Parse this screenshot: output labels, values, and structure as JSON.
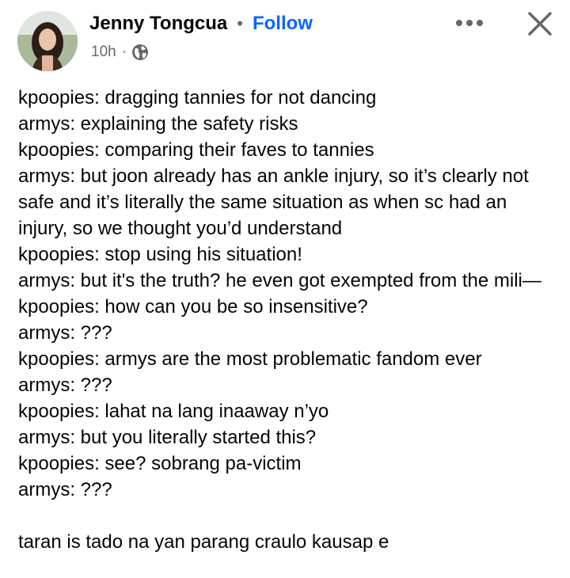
{
  "post": {
    "author": {
      "name": "Jenny Tongcua",
      "avatar_icon": "profile-photo"
    },
    "header": {
      "separator": "•",
      "follow_label": "Follow",
      "timestamp": "10h",
      "meta_separator": "·",
      "audience_icon": "globe-icon"
    },
    "actions": {
      "more_icon": "more-options-icon",
      "close_icon": "close-icon"
    },
    "lines": [
      "kpoopies: dragging tannies for not dancing",
      "armys: explaining the safety risks",
      "kpoopies: comparing their faves to tannies",
      "armys: but joon already has an ankle injury, so it’s clearly not safe and it’s literally the same situation as when sc had an injury, so we thought you’d understand",
      "kpoopies: stop using his situation!",
      "armys: but it's the truth? he even got exempted from the mili—",
      "kpoopies: how can you be so insensitive?",
      "armys: ???",
      "kpoopies: armys are the most problematic fandom ever",
      "armys: ???",
      "kpoopies: lahat na lang inaaway n’yo",
      "armys: but you literally started this?",
      "kpoopies: see? sobrang pa-victim",
      "armys: ???"
    ],
    "closing_line": "taran is tado na yan parang craulo kausap e"
  },
  "colors": {
    "text": "#050505",
    "secondary": "#65676b",
    "link": "#0866ff",
    "background": "#ffffff"
  }
}
